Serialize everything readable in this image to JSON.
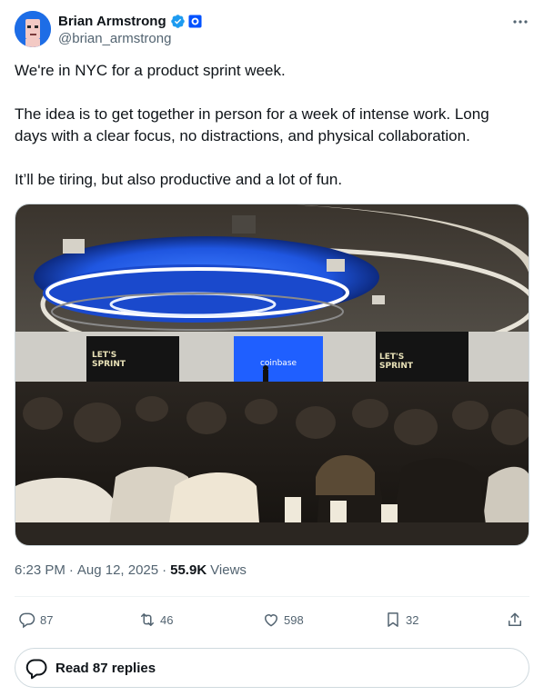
{
  "author": {
    "display_name": "Brian Armstrong",
    "handle": "@brian_armstrong",
    "verified_color": "#1d9bf0",
    "affiliation_color": "#0052ff"
  },
  "tweet": {
    "paragraphs": [
      "We're in NYC for a product sprint week.",
      "The idea is to get together in person for a week of intense work. Long days with a clear focus, no distractions, and physical collaboration.",
      "It’ll be tiring, but also productive and a lot of fun."
    ]
  },
  "media": {
    "screen_left_text_1": "LET'S",
    "screen_left_text_2": "SPRINT",
    "screen_center_text": "coinbase",
    "screen_right_text_1": "LET'S",
    "screen_right_text_2": "SPRINT"
  },
  "meta": {
    "time": "6:23 PM",
    "date": "Aug 12, 2025",
    "views_count": "55.9K",
    "views_label": "Views",
    "separator": "·"
  },
  "actions": {
    "replies": "87",
    "reposts": "46",
    "likes": "598",
    "bookmarks": "32"
  },
  "read_replies_label": "Read 87 replies",
  "icons": [
    "more-icon",
    "verified-icon",
    "affiliate-badge-icon",
    "reply-icon",
    "repost-icon",
    "like-icon",
    "bookmark-icon",
    "share-icon",
    "speech-bubble-icon"
  ]
}
